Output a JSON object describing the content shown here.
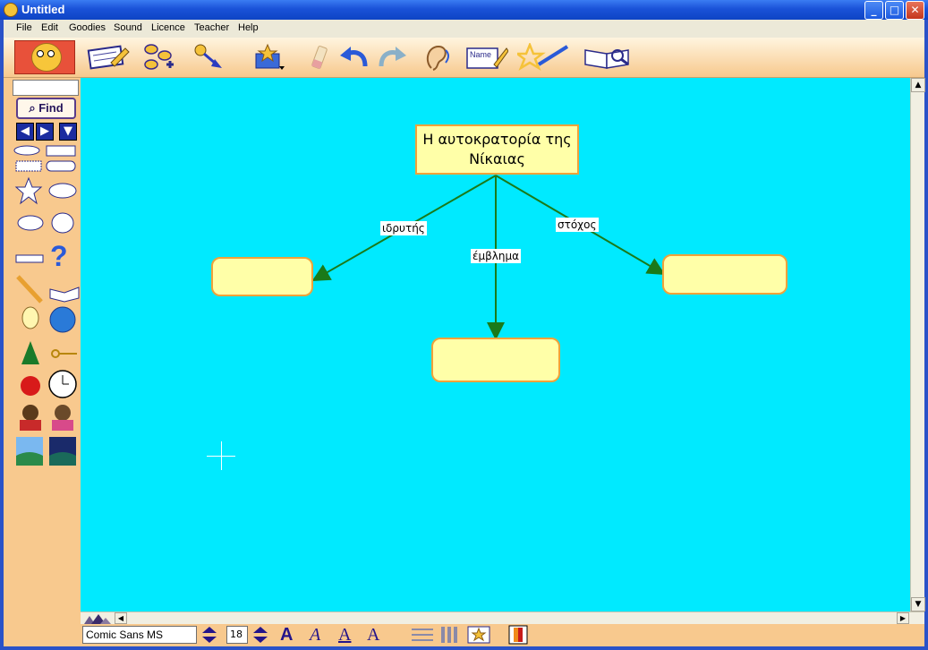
{
  "window": {
    "title": "Untitled"
  },
  "menu": [
    "File",
    "Edit",
    "Goodies",
    "Sound",
    "Licence",
    "Teacher",
    "Help"
  ],
  "toolbar": {
    "icons": [
      "note-pad-icon",
      "rapid-create-icon",
      "link-icon",
      "symbol-box-icon",
      "eraser-icon",
      "undo-icon",
      "redo-icon",
      "ear-icon",
      "name-tag-icon",
      "paintbrush-icon",
      "reading-book-icon"
    ]
  },
  "left_panel": {
    "search_value": "",
    "find_label": "Find"
  },
  "map": {
    "main_node": "Η αυτοκρατορία της Νίκαιας",
    "child_left": "",
    "child_middle": "",
    "child_right": "",
    "link_left": "ιδρυτής",
    "link_middle": "έμβλημα",
    "link_right": "στόχος"
  },
  "format_bar": {
    "font": "Comic Sans MS",
    "size": "18"
  },
  "colors": {
    "canvas": "#00eaff",
    "node_fill": "#ffffa8",
    "node_border": "#f0a23a",
    "link_line": "#1a7a1a"
  }
}
